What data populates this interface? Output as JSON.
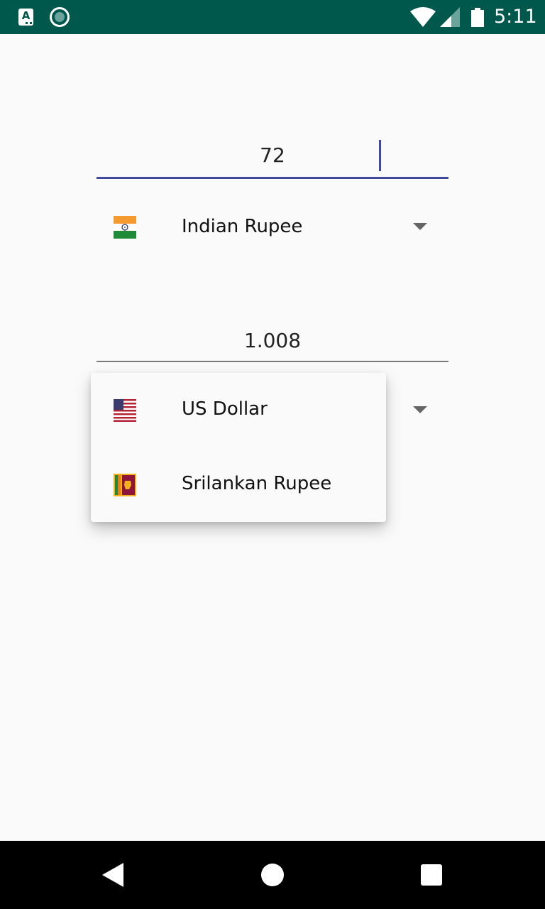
{
  "status_bar": {
    "time": "5:11",
    "icons": [
      "app-a-icon",
      "circle-status-icon",
      "wifi-icon",
      "signal-icon",
      "battery-icon"
    ]
  },
  "converter": {
    "amount_value": "72",
    "from_currency": {
      "label": "Indian Rupee",
      "flag": "india-flag-icon"
    },
    "result_value": "1.008",
    "to_currency_dropdown": {
      "options": [
        {
          "label": "US Dollar",
          "flag": "us-flag-icon"
        },
        {
          "label": "Srilankan Rupee",
          "flag": "sri-lanka-flag-icon"
        }
      ]
    }
  },
  "colors": {
    "status_bar": "#00574b",
    "accent": "#3f4a9e",
    "background": "#fafafa"
  },
  "nav_bar": {
    "icons": [
      "back-icon",
      "home-icon",
      "recents-icon"
    ]
  }
}
